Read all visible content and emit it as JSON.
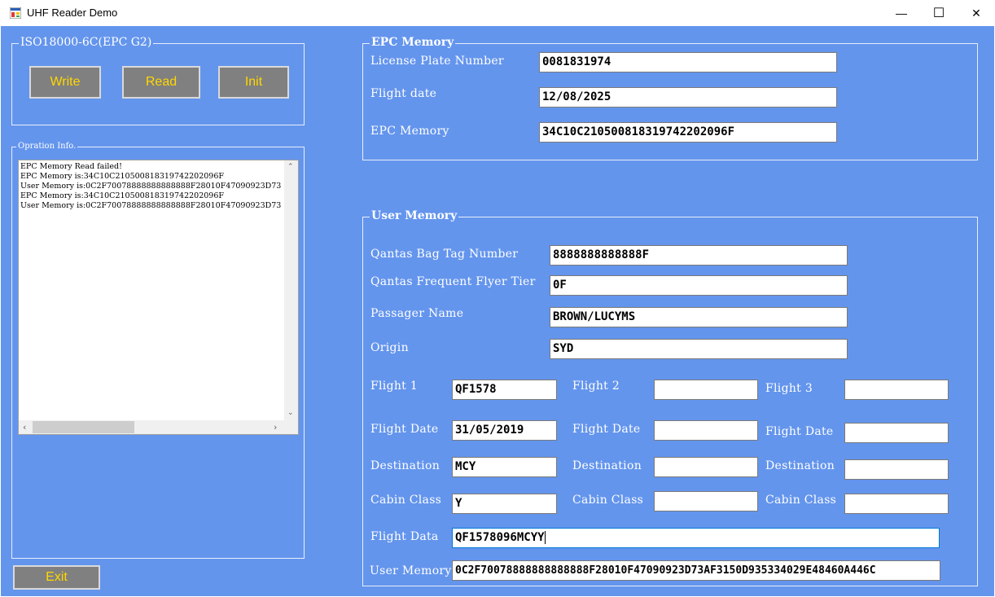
{
  "window": {
    "title": "UHF Reader Demo",
    "minimize": "—",
    "maximize": "☐",
    "close": "✕"
  },
  "iso_group": {
    "legend": "ISO18000-6C(EPC G2)",
    "write_label": "Write",
    "read_label": "Read",
    "init_label": "Init"
  },
  "info_group": {
    "legend": "Opration Info.",
    "log": [
      "EPC Memory Read failed!",
      "EPC Memory is:34C10C210500818319742202096F",
      "User Memory is:0C2F70078888888888888F28010F47090923D73",
      "EPC Memory is:34C10C210500818319742202096F",
      "User Memory is:0C2F70078888888888888F28010F47090923D73"
    ]
  },
  "exit_label": "Exit",
  "epc_group": {
    "legend": "EPC Memory",
    "license_label": "License Plate Number",
    "license_value": "0081831974",
    "flight_date_label": "Flight date",
    "flight_date_value": "12/08/2025",
    "epc_label": "EPC Memory",
    "epc_value": "34C10C210500818319742202096F"
  },
  "user_group": {
    "legend": "User Memory",
    "bag_tag_label": "Qantas Bag Tag Number",
    "bag_tag_value": "8888888888888F",
    "ff_tier_label": "Qantas Frequent Flyer Tier",
    "ff_tier_value": "0F",
    "passenger_label": "Passager Name",
    "passenger_value": "BROWN/LUCYMS",
    "origin_label": "Origin",
    "origin_value": "SYD",
    "flight1_label": "Flight 1",
    "flight1_value": "QF1578",
    "flight2_label": "Flight 2",
    "flight2_value": "",
    "flight3_label": "Flight 3",
    "flight3_value": "",
    "fdate_label": "Flight Date",
    "fdate1_value": "31/05/2019",
    "fdate2_value": "",
    "fdate3_value": "",
    "dest_label": "Destination",
    "dest1_value": "MCY",
    "dest2_value": "",
    "dest3_value": "",
    "cabin_label": "Cabin Class",
    "cabin1_value": "Y",
    "cabin2_value": "",
    "cabin3_value": "",
    "flight_data_label": "Flight Data",
    "flight_data_value": "QF1578096MCYY",
    "user_memory_label": "User Memory",
    "user_memory_value": "0C2F70078888888888888F28010F47090923D73AF3150D935334029E48460A446C"
  },
  "colors": {
    "background": "#6495ed",
    "button_face": "#808080",
    "button_text": "#ffd700"
  }
}
